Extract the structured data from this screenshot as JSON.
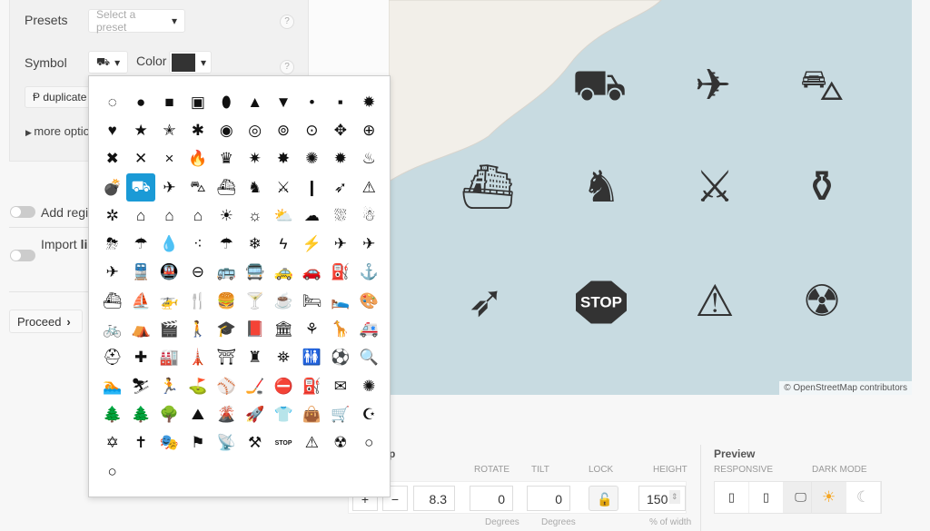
{
  "presets": {
    "label": "Presets",
    "placeholder": "Select a preset",
    "help": "?"
  },
  "symbol": {
    "label": "Symbol",
    "selected": "tank",
    "glyph": "⛟",
    "color_label": "Color",
    "color": "#333333",
    "help": "?"
  },
  "duplicate_label": "duplicate",
  "more_options": "more optio",
  "add_region": "Add regio",
  "import_lines": "Import ",
  "import_lines_bold": "lin",
  "proceed": "Proceed",
  "map": {
    "attribution": "© OpenStreetMap contributors",
    "markers": [
      {
        "name": "tank",
        "glyph": "⛟"
      },
      {
        "name": "plane",
        "glyph": "✈"
      },
      {
        "name": "tank-vehicle",
        "glyph": "⛍"
      },
      {
        "name": "ship",
        "glyph": "⛴"
      },
      {
        "name": "soldier",
        "glyph": "♞"
      },
      {
        "name": "rifle",
        "glyph": "⚔"
      },
      {
        "name": "bomb",
        "glyph": "⚱"
      },
      {
        "name": "missile",
        "glyph": "➶"
      },
      {
        "name": "stop",
        "glyph": "STOP"
      },
      {
        "name": "roadwork",
        "glyph": "⚠"
      },
      {
        "name": "radiation",
        "glyph": "☢"
      }
    ]
  },
  "symbols": [
    "◌",
    "●",
    "■",
    "▣",
    "⬮",
    "▲",
    "▼",
    "•",
    "▪",
    "✹",
    "♥",
    "★",
    "✭",
    "✱",
    "◉",
    "◎",
    "⊚",
    "⊙",
    "✥",
    "⊕",
    "✖",
    "✕",
    "×",
    "🔥",
    "♛",
    "✷",
    "✸",
    "✺",
    "✹",
    "♨",
    "💣",
    "⛟",
    "✈",
    "⛍",
    "⛴",
    "♞",
    "⚔",
    "❙",
    "➶",
    "⚠",
    "✲",
    "⌂",
    "⌂",
    "⌂",
    "☀",
    "☼",
    "⛅",
    "☁",
    "⛆",
    "☃",
    "⛈",
    "☂",
    "💧",
    "⁖",
    "☂",
    "❄",
    "ϟ",
    "⚡",
    "✈",
    "✈",
    "✈",
    "🚆",
    "🚇",
    "⊖",
    "🚌",
    "🚍",
    "🚕",
    "🚗",
    "⛽",
    "⚓",
    "⛴",
    "⛵",
    "🚁",
    "🍴",
    "🍔",
    "🍸",
    "☕",
    "🛏",
    "🛌",
    "🎨",
    "🚲",
    "⛺",
    "🎬",
    "🚶",
    "🎓",
    "📕",
    "🏛",
    "⚘",
    "🦒",
    "🚑",
    "⛑",
    "✚",
    "🏭",
    "🗼",
    "⛩",
    "♜",
    "⛯",
    "🚻",
    "⚽",
    "🔍",
    "🏊",
    "⛷",
    "🏃",
    "⛳",
    "⚾",
    "🏒",
    "⛔",
    "⛽",
    "✉",
    "✺",
    "🌲",
    "🌲",
    "🌳",
    "⛰",
    "🌋",
    "🚀",
    "👕",
    "👜",
    "🛒",
    "☪",
    "✡",
    "✝",
    "🎭",
    "⚑",
    "📡",
    "⚒",
    "STOP",
    "⚠",
    "☢",
    "○",
    "○"
  ],
  "selected_index": 31,
  "view": {
    "section": "p",
    "rotate_label": "ROTATE",
    "tilt_label": "TILT",
    "lock_label": "LOCK",
    "height_label": "HEIGHT",
    "zoom": "8.3",
    "rotate": "0",
    "tilt": "0",
    "height": "150",
    "degrees1": "Degrees",
    "degrees2": "Degrees",
    "pct": "% of width",
    "minus": "−",
    "plus": "+"
  },
  "preview": {
    "title": "Preview",
    "responsive_label": "RESPONSIVE",
    "dark_label": "DARK MODE",
    "sun_color": "#f5a623"
  }
}
